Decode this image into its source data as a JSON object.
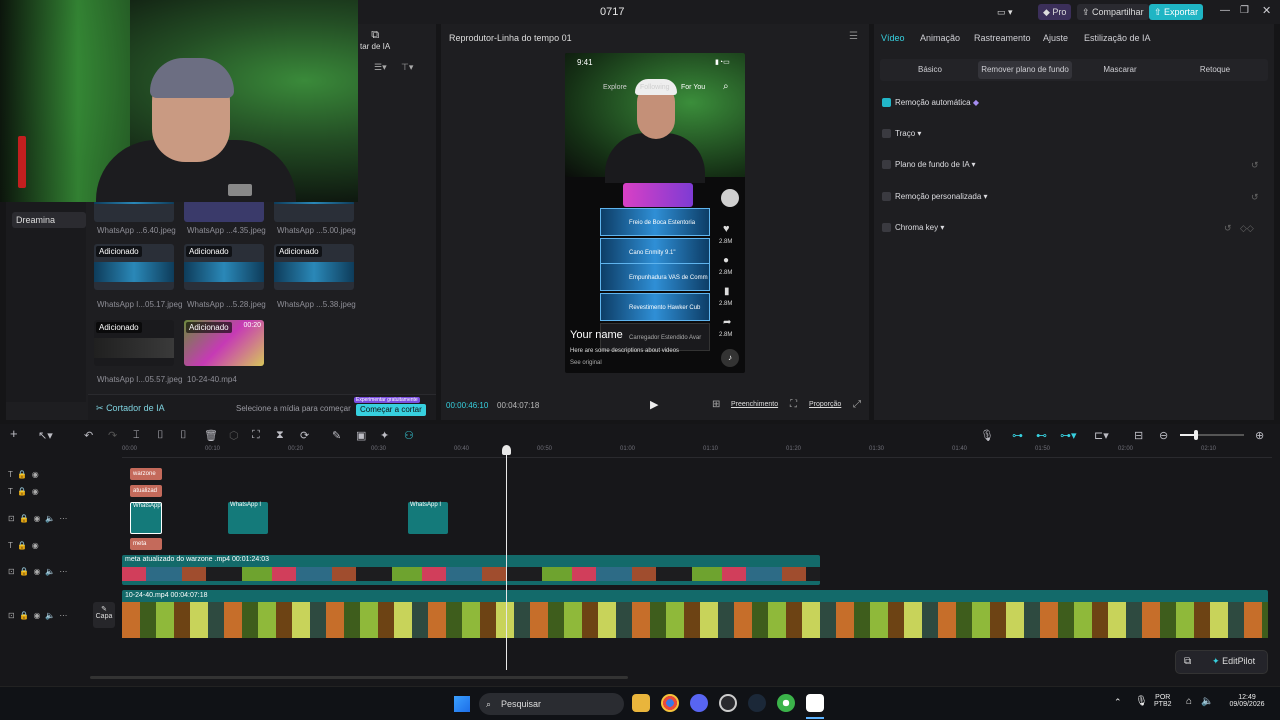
{
  "window": {
    "title": "0717",
    "pro_label": "Pro",
    "share_label": "Compartilhar",
    "export_label": "Exportar"
  },
  "media": {
    "panel_title": "tar de IA",
    "sidebar_items": [
      "Dreamina"
    ],
    "thumbs": [
      {
        "tag": "",
        "caption": "WhatsApp ...6.40.jpeg"
      },
      {
        "tag": "",
        "caption": "WhatsApp ...4.35.jpeg"
      },
      {
        "tag": "",
        "caption": "WhatsApp ...5.00.jpeg"
      },
      {
        "tag": "Adicionado",
        "caption": "WhatsApp I...05.17.jpeg"
      },
      {
        "tag": "Adicionado",
        "caption": "WhatsApp ...5.28.jpeg"
      },
      {
        "tag": "Adicionado",
        "caption": "WhatsApp ...5.38.jpeg"
      },
      {
        "tag": "Adicionado",
        "caption": "WhatsApp I...05.57.jpeg"
      },
      {
        "tag": "Adicionado",
        "caption": "10-24-40.mp4"
      }
    ],
    "thumb_duration": "00:20",
    "ai_cutter_label": "Cortador de IA",
    "select_prompt": "Selecione a mídia para começar",
    "trial_badge": "Experimentar gratuitamente",
    "start_cut_label": "Começar a cortar"
  },
  "player": {
    "title": "Reprodutor-Linha do tempo 01",
    "phone": {
      "time": "9:41",
      "tab_explore": "Explore",
      "tab_following": "Following",
      "tab_foryou": "For You",
      "username": "Your name",
      "description": "Here are some descriptions about videos",
      "see_original": "See original",
      "count": "2.8M",
      "rows": [
        "Freio de Boca Estentoria",
        "Cano Enmity 9.1\"",
        "Empunhadura VAS de Comm",
        "Revestimento Hawker Cub",
        "Carregador Estendido Avar"
      ]
    },
    "current_time": "00:00:46:10",
    "total_time": "00:04:07:18",
    "fill_label": "Preenchimento",
    "ratio_label": "Proporção"
  },
  "props": {
    "tabs": [
      "Vídeo",
      "Animação",
      "Rastreamento",
      "Ajuste",
      "Estilização de IA"
    ],
    "subtabs": [
      "Básico",
      "Remover plano de fundo",
      "Mascarar",
      "Retoque"
    ],
    "options": [
      {
        "label": "Remoção automática",
        "checked": true
      },
      {
        "label": "Traço",
        "checked": false
      },
      {
        "label": "Plano de fundo de IA",
        "checked": false
      },
      {
        "label": "Remoção personalizada",
        "checked": false
      },
      {
        "label": "Chroma key",
        "checked": false
      }
    ]
  },
  "timeline": {
    "ruler": [
      "00:00",
      "00:10",
      "00:20",
      "00:30",
      "00:40",
      "00:50",
      "01:00",
      "01:10",
      "01:20",
      "01:30",
      "01:40",
      "01:50",
      "02:00",
      "02:10"
    ],
    "clips_red": [
      "warzone",
      "atualizad",
      "meta"
    ],
    "clips_teal": [
      "WhatsApp",
      "WhatsApp I",
      "WhatsApp I"
    ],
    "video1_label": "meta atualizado do warzone .mp4  00:01:24:03",
    "video2_label": "10-24-40.mp4  00:04:07:18",
    "cover_label": "Capa",
    "editpilot_label": "EditPilot"
  },
  "taskbar": {
    "search_placeholder": "Pesquisar",
    "lang": "POR",
    "layout": "PTB2",
    "time": "12:49",
    "date": "09/09/2026"
  }
}
